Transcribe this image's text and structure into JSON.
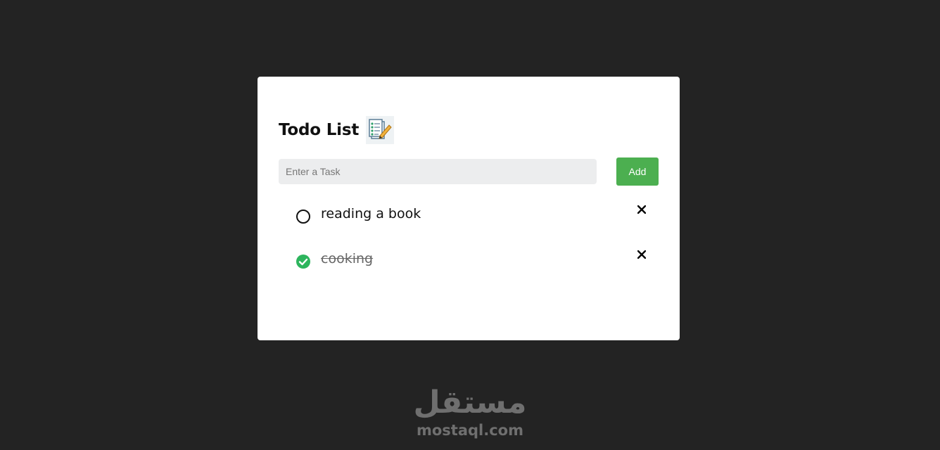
{
  "app": {
    "title": "Todo List",
    "title_icon": "notepad-pencil-icon"
  },
  "input": {
    "placeholder": "Enter a Task",
    "value": "",
    "add_label": "Add"
  },
  "tasks": [
    {
      "text": "reading a book",
      "done": false
    },
    {
      "text": "cooking",
      "done": true
    }
  ],
  "delete_symbol": "✕",
  "colors": {
    "background": "#232323",
    "card": "#ffffff",
    "accent": "#4caf50",
    "check_done": "#2db55d"
  },
  "watermark": {
    "arabic": "مستقل",
    "latin": "mostaql.com"
  }
}
